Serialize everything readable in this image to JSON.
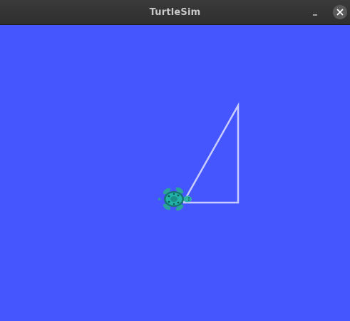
{
  "window": {
    "title": "TurtleSim"
  },
  "titlebar": {
    "minimize_icon": "minimize-icon",
    "close_icon": "close-icon"
  },
  "canvas": {
    "background_color": "#4556ff",
    "trail_color": "#c9ccff",
    "turtle_icon": "turtle-icon"
  }
}
